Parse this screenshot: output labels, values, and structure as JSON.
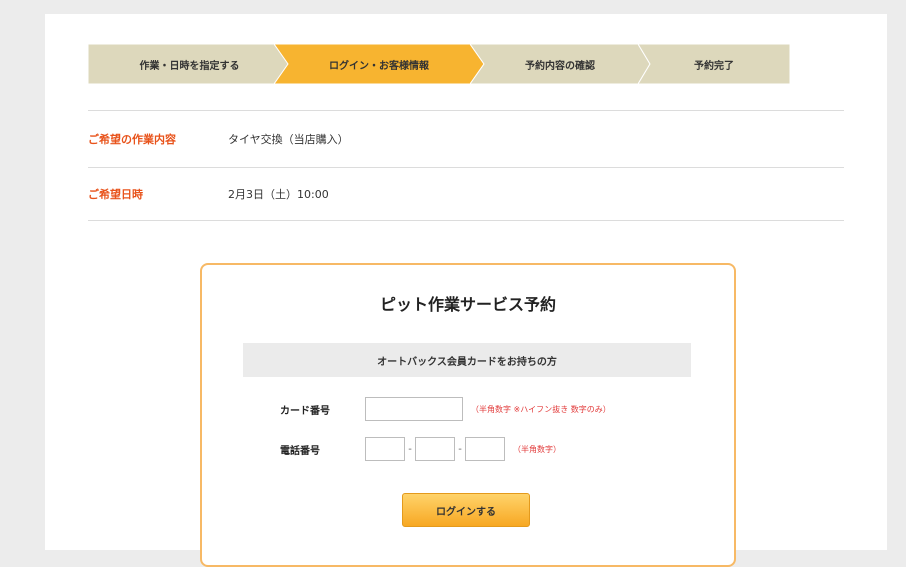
{
  "steps": [
    {
      "label": "作業・日時を指定する",
      "active": false
    },
    {
      "label": "ログイン・お客様情報",
      "active": true
    },
    {
      "label": "予約内容の確認",
      "active": false
    },
    {
      "label": "予約完了",
      "active": false
    }
  ],
  "info": {
    "work_label": "ご希望の作業内容",
    "work_value": "タイヤ交換（当店購入）",
    "date_label": "ご希望日時",
    "date_value": "2月3日（土）10:00"
  },
  "login": {
    "title": "ピット作業サービス予約",
    "banner": "オートバックス会員カードをお持ちの方",
    "card_label": "カード番号",
    "card_note": "（半角数字 ※ハイフン抜き 数字のみ）",
    "phone_label": "電話番号",
    "phone_note": "（半角数字）",
    "phone_sep": "-",
    "submit_label": "ログインする"
  },
  "colors": {
    "step_inactive": "#ddd8bc",
    "step_active": "#f7b430",
    "label_accent": "#e8531b",
    "box_border": "#f7b965"
  }
}
